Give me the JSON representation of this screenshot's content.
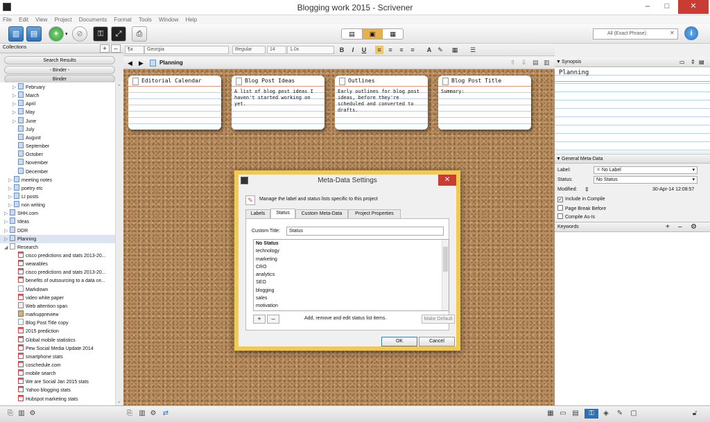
{
  "window": {
    "title": "Blogging work 2015 - Scrivener",
    "minimize": "–",
    "maximize": "□",
    "close": "✕"
  },
  "menu": [
    "File",
    "Edit",
    "View",
    "Project",
    "Documents",
    "Format",
    "Tools",
    "Window",
    "Help"
  ],
  "search": {
    "placeholder": "All (Exact Phrase)"
  },
  "help_label": "i",
  "binder": {
    "collections_label": "Collections",
    "add_label": "+",
    "remove_label": "–",
    "tabs": [
      "Search Results",
      "- Binder -",
      "Binder"
    ],
    "items": [
      {
        "label": "February",
        "indent": 1,
        "icon": "folder",
        "tri": "▷"
      },
      {
        "label": "March",
        "indent": 1,
        "icon": "folder",
        "tri": "▷"
      },
      {
        "label": "April",
        "indent": 1,
        "icon": "folder",
        "tri": "▷"
      },
      {
        "label": "May",
        "indent": 1,
        "icon": "folder",
        "tri": "▷"
      },
      {
        "label": "June",
        "indent": 1,
        "icon": "folder",
        "tri": "▷"
      },
      {
        "label": "July",
        "indent": 1,
        "icon": "folder",
        "tri": ""
      },
      {
        "label": "August",
        "indent": 1,
        "icon": "folder",
        "tri": ""
      },
      {
        "label": "September",
        "indent": 1,
        "icon": "folder",
        "tri": ""
      },
      {
        "label": "October",
        "indent": 1,
        "icon": "folder",
        "tri": ""
      },
      {
        "label": "November",
        "indent": 1,
        "icon": "folder",
        "tri": ""
      },
      {
        "label": "December",
        "indent": 1,
        "icon": "folder",
        "tri": ""
      },
      {
        "label": "meeting notes",
        "indent": 0.5,
        "icon": "folder",
        "tri": "▷"
      },
      {
        "label": "poetry etc",
        "indent": 0.5,
        "icon": "folder",
        "tri": "▷"
      },
      {
        "label": "LI posts",
        "indent": 0.5,
        "icon": "folder",
        "tri": "▷"
      },
      {
        "label": "non writing",
        "indent": 0.5,
        "icon": "folder",
        "tri": "▷"
      },
      {
        "label": "SHH.com",
        "indent": 0,
        "icon": "folder",
        "tri": "▷"
      },
      {
        "label": "Ideas",
        "indent": 0,
        "icon": "folder",
        "tri": "▷"
      },
      {
        "label": "DDR",
        "indent": 0,
        "icon": "folder",
        "tri": "▷"
      },
      {
        "label": "Planning",
        "indent": 0,
        "icon": "folder",
        "tri": "▷",
        "selected": true
      },
      {
        "label": "Research",
        "indent": 0,
        "icon": "research",
        "tri": "◢"
      },
      {
        "label": "cisco predictions and stats 2013-20...",
        "indent": 1,
        "icon": "red",
        "tri": ""
      },
      {
        "label": "wearables",
        "indent": 1,
        "icon": "red",
        "tri": ""
      },
      {
        "label": "cisco predictions and stats 2013-20...",
        "indent": 1,
        "icon": "red",
        "tri": ""
      },
      {
        "label": "benefits of outsourcing to a data ce...",
        "indent": 1,
        "icon": "red",
        "tri": ""
      },
      {
        "label": "Markdown",
        "indent": 1,
        "icon": "doc",
        "tri": ""
      },
      {
        "label": "video white paper",
        "indent": 1,
        "icon": "red",
        "tri": ""
      },
      {
        "label": "Web attention span",
        "indent": 1,
        "icon": "grey",
        "tri": ""
      },
      {
        "label": "markuppreview",
        "indent": 1,
        "icon": "img",
        "tri": ""
      },
      {
        "label": "Blog Post Title copy",
        "indent": 1,
        "icon": "doc",
        "tri": ""
      },
      {
        "label": "2015 prediction",
        "indent": 1,
        "icon": "red",
        "tri": ""
      },
      {
        "label": "Global mobile statistics",
        "indent": 1,
        "icon": "red",
        "tri": ""
      },
      {
        "label": "Pew Social Media Update 2014",
        "indent": 1,
        "icon": "red",
        "tri": ""
      },
      {
        "label": "smartphone stats",
        "indent": 1,
        "icon": "red",
        "tri": ""
      },
      {
        "label": "coschedule.com",
        "indent": 1,
        "icon": "red",
        "tri": ""
      },
      {
        "label": "mobile search",
        "indent": 1,
        "icon": "red",
        "tri": ""
      },
      {
        "label": "We are Social Jan 2015 stats",
        "indent": 1,
        "icon": "red",
        "tri": ""
      },
      {
        "label": "Yahoo blogging stats",
        "indent": 1,
        "icon": "red",
        "tri": ""
      },
      {
        "label": "Hubspot marketing stats",
        "indent": 1,
        "icon": "red",
        "tri": ""
      }
    ]
  },
  "format": {
    "style": "¶a",
    "font": "Georgia",
    "weight": "Regular",
    "size": "14",
    "spacing": "1.0x",
    "bold": "B",
    "italic": "I",
    "underline": "U"
  },
  "editor": {
    "title": "Planning"
  },
  "cards": [
    {
      "title": "Editorial Calendar",
      "body": ""
    },
    {
      "title": "Blog Post Ideas",
      "body": "A list of blog post ideas I haven't started working on yet."
    },
    {
      "title": "Outlines",
      "body": "Early outlines for blog post ideas, before they're scheduled and converted to drafts."
    },
    {
      "title": "Blog Post Title",
      "body": "Summary:"
    }
  ],
  "inspector": {
    "synopsis_label": "Synopsis",
    "synopsis_title": "Planning",
    "meta_header": "General Meta-Data",
    "label_label": "Label:",
    "label_value": "No Label",
    "status_label": "Status:",
    "status_value": "No Status",
    "modified_label": "Modified:",
    "modified_value": "30-Apr-14 12:08:57",
    "include_compile": "Include in Compile",
    "page_break": "Page Break Before",
    "compile_as_is": "Compile As-Is",
    "keywords_label": "Keywords"
  },
  "dialog": {
    "title": "Meta-Data Settings",
    "close": "✕",
    "message": "Manage the label and status lists specific to this project",
    "tabs": [
      "Labels",
      "Status",
      "Custom Meta-Data",
      "Project Properties"
    ],
    "custom_title_label": "Custom Title:",
    "custom_title_value": "Status",
    "statuses": [
      "No Status",
      "technology",
      "marketing",
      "CRO",
      "analytics",
      "SEO",
      "blogging",
      "sales",
      "motivation"
    ],
    "add": "+",
    "remove": "–",
    "help_text": "Add, remove and edit status list items.",
    "make_default": "Make Default",
    "ok": "OK",
    "cancel": "Cancel"
  }
}
